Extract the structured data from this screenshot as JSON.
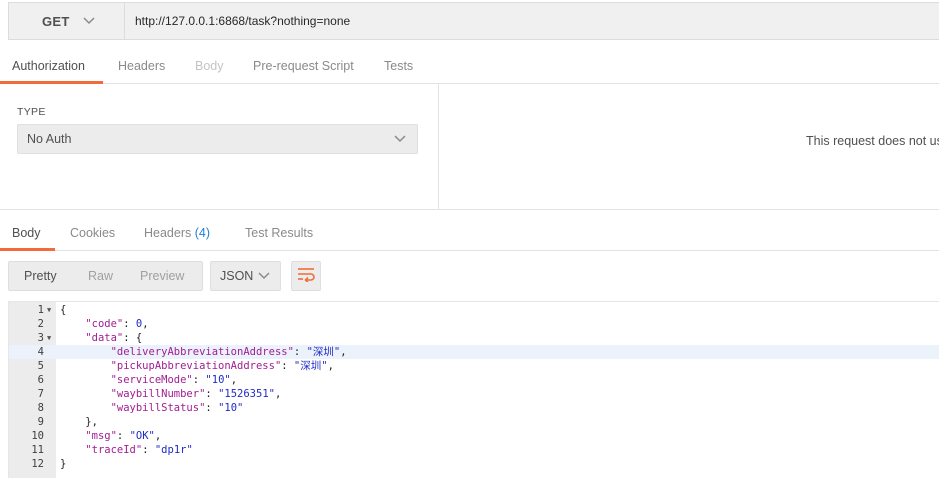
{
  "request": {
    "method": "GET",
    "url": "http://127.0.0.1:6868/task?nothing=none"
  },
  "request_tabs": [
    {
      "label": "Authorization",
      "state": "active"
    },
    {
      "label": "Headers",
      "state": "normal"
    },
    {
      "label": "Body",
      "state": "disabled"
    },
    {
      "label": "Pre-request Script",
      "state": "normal"
    },
    {
      "label": "Tests",
      "state": "normal"
    }
  ],
  "auth": {
    "type_label": "TYPE",
    "selected": "No Auth",
    "message": "This request does not us"
  },
  "response_tabs": {
    "body": "Body",
    "cookies": "Cookies",
    "headers": "Headers",
    "headers_count": "(4)",
    "test_results": "Test Results"
  },
  "view_modes": {
    "pretty": "Pretty",
    "raw": "Raw",
    "preview": "Preview",
    "format": "JSON"
  },
  "colors": {
    "accent": "#f26b3a",
    "link": "#1f82d9",
    "json_key": "#a11d92",
    "json_value": "#1f2bc7"
  },
  "code_lines": [
    {
      "n": "1",
      "fold": true,
      "text": "{"
    },
    {
      "n": "2",
      "fold": false,
      "key": "code",
      "value": "0",
      "kind": "num",
      "indent": 1,
      "trail": ","
    },
    {
      "n": "3",
      "fold": true,
      "key": "data",
      "text": "{",
      "indent": 1
    },
    {
      "n": "4",
      "fold": false,
      "key": "deliveryAbbreviationAddress",
      "value": "\"深圳\"",
      "kind": "str",
      "indent": 2,
      "trail": ",",
      "highlight": true
    },
    {
      "n": "5",
      "fold": false,
      "key": "pickupAbbreviationAddress",
      "value": "\"深圳\"",
      "kind": "str",
      "indent": 2,
      "trail": ","
    },
    {
      "n": "6",
      "fold": false,
      "key": "serviceMode",
      "value": "\"10\"",
      "kind": "str",
      "indent": 2,
      "trail": ","
    },
    {
      "n": "7",
      "fold": false,
      "key": "waybillNumber",
      "value": "\"1526351\"",
      "kind": "str",
      "indent": 2,
      "trail": ","
    },
    {
      "n": "8",
      "fold": false,
      "key": "waybillStatus",
      "value": "\"10\"",
      "kind": "str",
      "indent": 2,
      "trail": ""
    },
    {
      "n": "9",
      "fold": false,
      "text": "},",
      "indent": 1
    },
    {
      "n": "10",
      "fold": false,
      "key": "msg",
      "value": "\"OK\"",
      "kind": "str",
      "indent": 1,
      "trail": ","
    },
    {
      "n": "11",
      "fold": false,
      "key": "traceId",
      "value": "\"dp1r\"",
      "kind": "str",
      "indent": 1,
      "trail": ""
    },
    {
      "n": "12",
      "fold": false,
      "text": "}"
    }
  ]
}
